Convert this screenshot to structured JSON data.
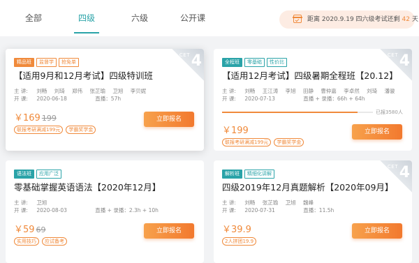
{
  "tabs": [
    "全部",
    "四级",
    "六级",
    "公开课"
  ],
  "active_tab": 1,
  "countdown": {
    "prefix": "距离 2020.9.19 四六级考试还剩",
    "days": "42",
    "suffix": "天"
  },
  "corner": {
    "cet": "CET",
    "level": "4"
  },
  "labels": {
    "teacher": "主 讲:",
    "date": "开 课:"
  },
  "cards": [
    {
      "tags": [
        "精品班",
        "监督学",
        "抢免单"
      ],
      "title": "【适用9月和12月考试】四级特训班",
      "teachers": [
        "刘畅",
        "刘琦",
        "郑伟",
        "张芷瑜",
        "卫旭",
        "李贝妮"
      ],
      "date": "2020-06-18",
      "mode": "直播：57h",
      "price": "￥169",
      "original": "199",
      "benefits": [
        "联报考研满减199元",
        "学霸奖学金"
      ],
      "button": "立即报名"
    },
    {
      "tags": [
        "全程班",
        "零基础",
        "性价比"
      ],
      "title": "【适用12月考试】四级暑期全程班【20.12】",
      "teachers": [
        "刘畅",
        "王江涛",
        "李旭",
        "田静",
        "曹仲嘉",
        "李卓然",
        "刘琦",
        "潘骏"
      ],
      "date": "2020-07-13",
      "mode": "直播 + 录播：66h + 64h",
      "enrolled": "已报3580人",
      "progress": 0.9,
      "price": "￥199",
      "original": "",
      "benefits": [
        "联报考研满减199元",
        "学霸奖学金"
      ],
      "button": "立即报名"
    },
    {
      "tags": [
        "语法班",
        "应用广泛"
      ],
      "title": "零基础掌握英语语法【2020年12月】",
      "teachers": [
        "卫旭"
      ],
      "date": "2020-08-03",
      "mode": "直播 + 录播：2.3h + 10h",
      "price": "￥59",
      "original": "69",
      "benefits": [
        "实用技巧",
        "应试备考"
      ],
      "button": "立即报名"
    },
    {
      "tags": [
        "解析班",
        "精细化讲解"
      ],
      "title": "四级2019年12月真题解析【2020年09月】",
      "teachers": [
        "刘畅",
        "张芷瑜",
        "卫旭",
        "魏峰"
      ],
      "date": "2020-07-31",
      "mode": "直播：11.5h",
      "price": "￥39.9",
      "original": "",
      "benefits": [
        "2人拼团19.9"
      ],
      "button": "立即报名"
    }
  ],
  "colors": {
    "accent": "#2aa3a8",
    "orange": "#f08a3b"
  }
}
